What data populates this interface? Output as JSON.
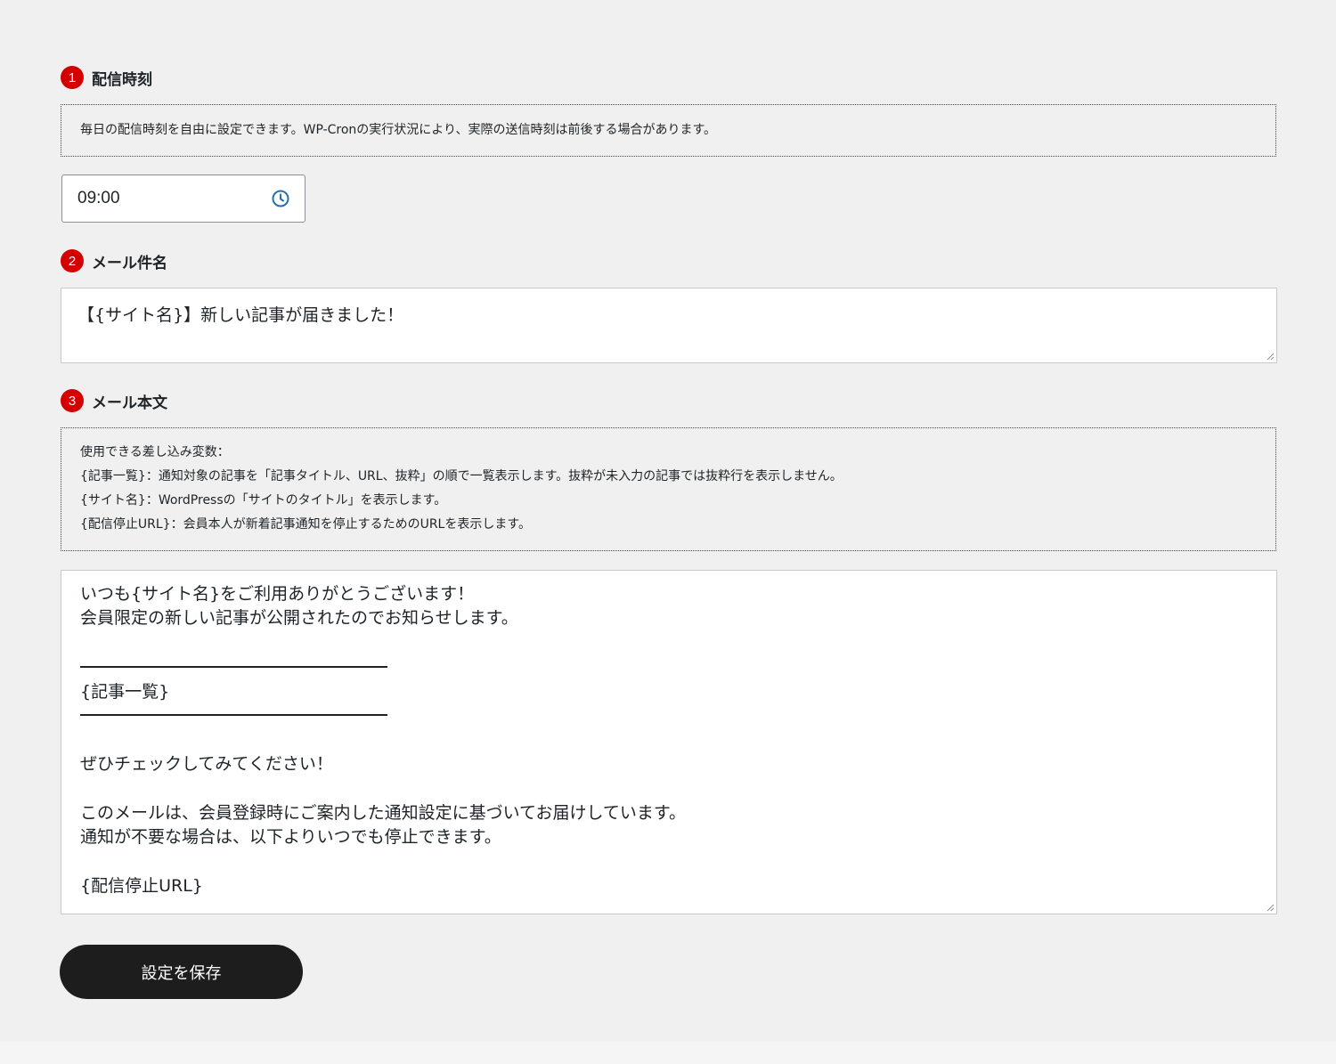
{
  "sections": {
    "time": {
      "number": "1",
      "title": "配信時刻",
      "notice": "毎日の配信時刻を自由に設定できます。WP-Cronの実行状況により、実際の送信時刻は前後する場合があります。",
      "value": "09:00",
      "icon": "clock-icon"
    },
    "subject": {
      "number": "2",
      "title": "メール件名",
      "value": "【{サイト名}】新しい記事が届きました！"
    },
    "body": {
      "number": "3",
      "title": "メール本文",
      "notice_lines": [
        "使用できる差し込み変数：",
        "{記事一覧}：通知対象の記事を「記事タイトル、URL、抜粋」の順で一覧表示します。抜粋が未入力の記事では抜粋行を表示しません。",
        "{サイト名}：WordPressの「サイトのタイトル」を表示します。",
        "{配信停止URL}：会員本人が新着記事通知を停止するためのURLを表示します。"
      ],
      "lines": [
        "いつも{サイト名}をご利用ありがとうございます！",
        "会員限定の新しい記事が公開されたのでお知らせします。",
        "{記事一覧}",
        "ぜひチェックしてみてください！",
        "このメールは、会員登録時にご案内した通知設定に基づいてお届けしています。",
        "通知が不要な場合は、以下よりいつでも停止できます。",
        "{配信停止URL}"
      ]
    }
  },
  "save_button": {
    "label": "設定を保存"
  },
  "colors": {
    "badge": "#d40000",
    "icon": "#2271b1",
    "button": "#1d1d1d",
    "background": "#f0f0f0"
  }
}
